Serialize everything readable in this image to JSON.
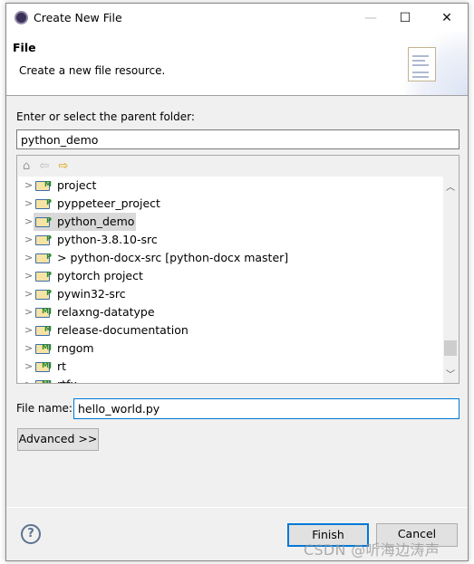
{
  "window": {
    "title": "Create New File",
    "minimize": "—",
    "maximize": "☐",
    "close": "✕"
  },
  "header": {
    "title": "File",
    "description": "Create a new file resource."
  },
  "parent_folder": {
    "label": "Enter or select the parent folder:",
    "value": "python_demo"
  },
  "tree": {
    "toolbar": {
      "home": "⌂",
      "back": "⇦",
      "forward": "⇨"
    },
    "items": [
      {
        "label": "project",
        "badge": "M",
        "selected": false
      },
      {
        "label": "pyppeteer_project",
        "badge": "P",
        "selected": false
      },
      {
        "label": "python_demo",
        "badge": "P",
        "selected": true
      },
      {
        "label": "python-3.8.10-src",
        "badge": "P",
        "selected": false
      },
      {
        "label": "> python-docx-src [python-docx master]",
        "badge": "P",
        "selected": false
      },
      {
        "label": "pytorch project",
        "badge": "P",
        "selected": false
      },
      {
        "label": "pywin32-src",
        "badge": "P",
        "selected": false
      },
      {
        "label": "relaxng-datatype",
        "badge": "MJ",
        "selected": false
      },
      {
        "label": "release-documentation",
        "badge": "M",
        "selected": false
      },
      {
        "label": "rngom",
        "badge": "MJ",
        "selected": false
      },
      {
        "label": "rt",
        "badge": "MJ",
        "selected": false
      },
      {
        "label": "rtfx",
        "badge": "MJ",
        "selected": false
      }
    ],
    "scroll_position_percent": 82
  },
  "file_name": {
    "label": "File name:",
    "value": "hello_world.py"
  },
  "buttons": {
    "advanced": "Advanced >>",
    "finish": "Finish",
    "cancel": "Cancel",
    "help": "?"
  },
  "watermark": "CSDN @听海边涛声",
  "colors": {
    "focus": "#0078d7",
    "selection": "#d9d9d9"
  }
}
